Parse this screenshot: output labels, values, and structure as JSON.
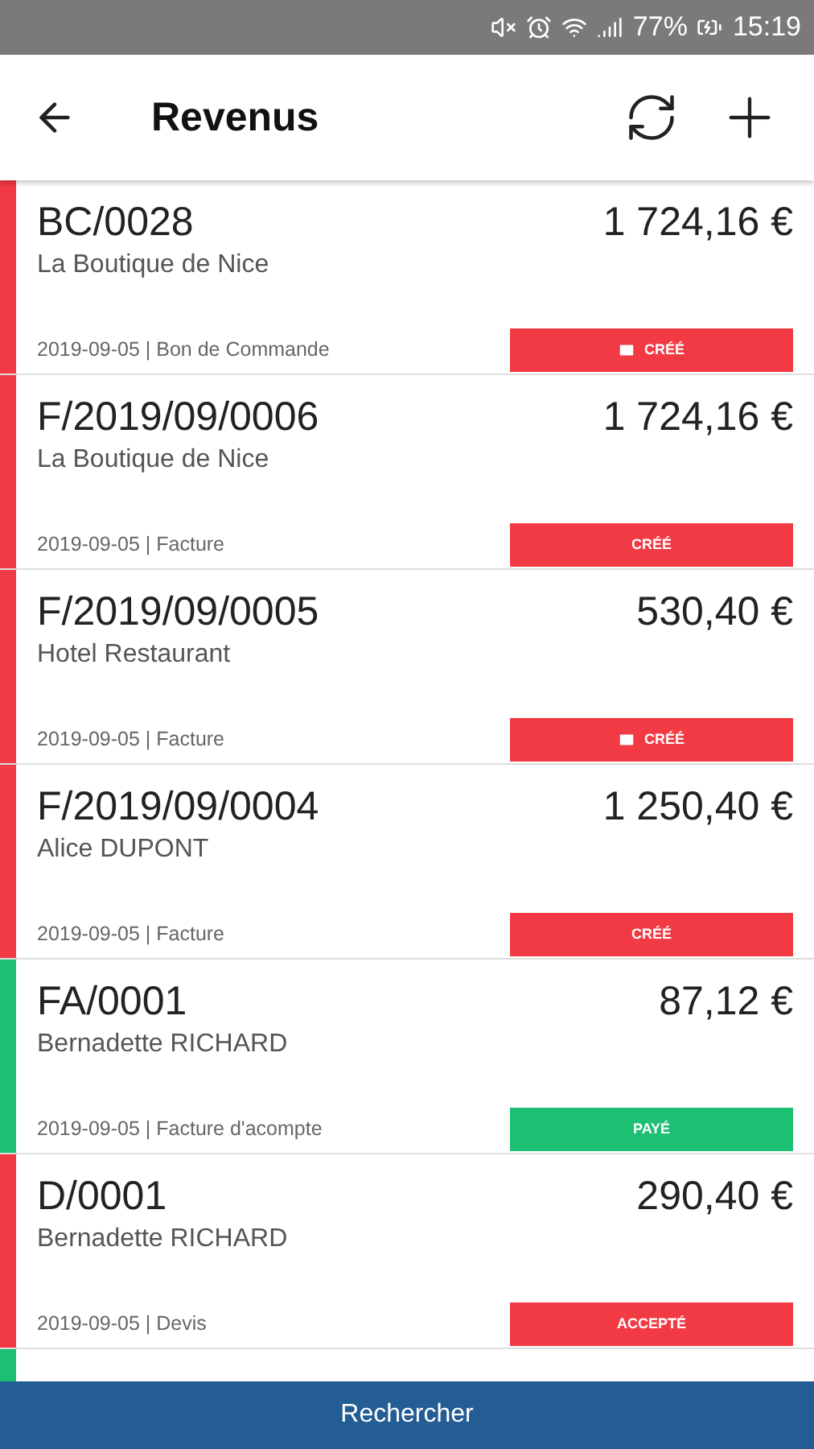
{
  "status_bar": {
    "battery": "77%",
    "time": "15:19"
  },
  "app_bar": {
    "title": "Revenus"
  },
  "rows": [
    {
      "number": "BC/0028",
      "client": "La Boutique de Nice",
      "amount": "1 724,16 €",
      "meta": "2019-09-05 | Bon de Commande",
      "status": "CRÉÉ",
      "mail": true,
      "color": "#f23a44"
    },
    {
      "number": "F/2019/09/0006",
      "client": "La Boutique de Nice",
      "amount": "1 724,16 €",
      "meta": "2019-09-05 | Facture",
      "status": "CRÉÉ",
      "mail": false,
      "color": "#f23a44"
    },
    {
      "number": "F/2019/09/0005",
      "client": "Hotel Restaurant",
      "amount": "530,40 €",
      "meta": "2019-09-05 | Facture",
      "status": "CRÉÉ",
      "mail": true,
      "color": "#f23a44"
    },
    {
      "number": "F/2019/09/0004",
      "client": "Alice DUPONT",
      "amount": "1 250,40 €",
      "meta": "2019-09-05 | Facture",
      "status": "CRÉÉ",
      "mail": false,
      "color": "#f23a44"
    },
    {
      "number": "FA/0001",
      "client": "Bernadette RICHARD",
      "amount": "87,12 €",
      "meta": "2019-09-05 | Facture d'acompte",
      "status": "PAYÉ",
      "mail": false,
      "color": "#1dbf73"
    },
    {
      "number": "D/0001",
      "client": "Bernadette RICHARD",
      "amount": "290,40 €",
      "meta": "2019-09-05 | Devis",
      "status": "ACCEPTÉ",
      "mail": false,
      "color": "#f23a44"
    },
    {
      "color": "#1dbf73"
    }
  ],
  "bottom_button": "Rechercher"
}
